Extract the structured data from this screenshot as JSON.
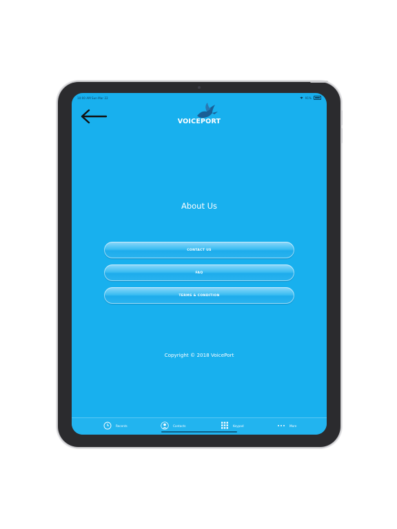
{
  "status_bar": {
    "time": "10:00 AM",
    "date": "Sun Mar 22",
    "battery": "91%"
  },
  "header": {
    "logo_text": "VOICEPORT"
  },
  "main": {
    "title": "About Us",
    "buttons": [
      {
        "label": "CONTACT US"
      },
      {
        "label": "FAQ"
      },
      {
        "label": "TERMS & CONDITION"
      }
    ],
    "copyright": "Copyright © 2018 VoicePort"
  },
  "tabbar": {
    "items": [
      {
        "label": "Recents",
        "icon": "clock-icon"
      },
      {
        "label": "Contacts",
        "icon": "person-icon"
      },
      {
        "label": "Keypad",
        "icon": "keypad-icon"
      },
      {
        "label": "More",
        "icon": "more-dots-icon"
      }
    ]
  },
  "colors": {
    "background": "#18b0ee",
    "text": "#ffffff"
  }
}
